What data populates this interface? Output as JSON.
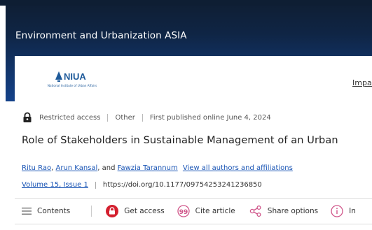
{
  "journal": {
    "title": "Environment and Urbanization ASIA"
  },
  "society": {
    "logo_text": "NIUA",
    "logo_subtitle": "National Institute of Urban Affairs"
  },
  "nav": {
    "impact_label": "Impact"
  },
  "article": {
    "access_label": "Restricted access",
    "article_type": "Other",
    "published": "First published online June 4, 2024",
    "title": "Role of Stakeholders in Sustainable Management of an Urban",
    "authors": [
      "Ritu Rao",
      "Arun Kansal",
      "Fawzia Tarannum"
    ],
    "author_sep_1": ", ",
    "author_sep_2": ", and ",
    "view_authors_label": "View all authors and affiliations",
    "volume_issue": "Volume 15, Issue 1",
    "doi": "https://doi.org/10.1177/09754253241236850"
  },
  "toolbar": {
    "contents_label": "Contents",
    "get_access_label": "Get access",
    "cite_label": "Cite article",
    "share_label": "Share options",
    "info_label": "In"
  },
  "colors": {
    "banner_dark": "#0f1f35",
    "banner_blue": "#14428a",
    "link": "#1a55b5",
    "access_red": "#d4202f",
    "cite_pink": "#d0568a"
  }
}
